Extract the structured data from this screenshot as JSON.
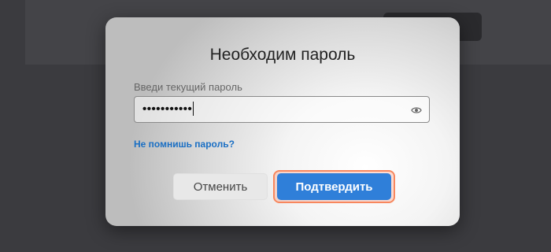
{
  "background": {
    "button_glyph": "••"
  },
  "dialog": {
    "title": "Необходим пароль",
    "field_label": "Введи текущий пароль",
    "password_value": "•••••••••••",
    "show_password_icon": "eye-icon",
    "forgot_link": "Не помнишь пароль?",
    "cancel_label": "Отменить",
    "confirm_label": "Подтвердить"
  },
  "colors": {
    "primary": "#2f7fd9",
    "link": "#1a6fc4",
    "focus_highlight": "#f7875e",
    "overlay": "#3b3b3f"
  }
}
